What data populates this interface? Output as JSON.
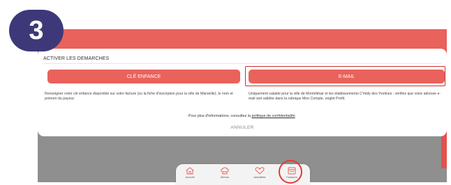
{
  "step_badge": {
    "number": "3"
  },
  "modal": {
    "title": "ACTIVER LES DEMARCHES",
    "buttons": {
      "cle_enfance": "CLÉ ENFANCE",
      "email": "E-MAIL"
    },
    "descriptions": {
      "cle_enfance": "Renseigner votre clé enfance disponible sur votre facture (ou la fiche d'inscription pour la ville de Marseille), le nom et prénom du payeur.",
      "email": "Uniquement valable pour la ville de Montélimar et les établissements C'midy des Yvelines : vérifiez que votre adresse e-mail soit validée dans la rubrique Mon Compte, onglet Profil."
    },
    "info_prefix": "Pour plus d'informations, consultez la ",
    "info_link": "politique de confidentialité",
    "info_suffix": ".",
    "cancel": "ANNULER"
  },
  "bottom_nav": {
    "items": [
      {
        "label": "Accueil",
        "icon": "home-icon"
      },
      {
        "label": "Menus",
        "icon": "chef-hat-icon"
      },
      {
        "label": "Actualités",
        "icon": "heart-icon"
      },
      {
        "label": "Factures",
        "icon": "invoice-icon"
      }
    ]
  },
  "colors": {
    "accent": "#e9625c",
    "badge": "#3d3978",
    "highlight": "#c9302c",
    "overlay": "#8f8f8f"
  }
}
